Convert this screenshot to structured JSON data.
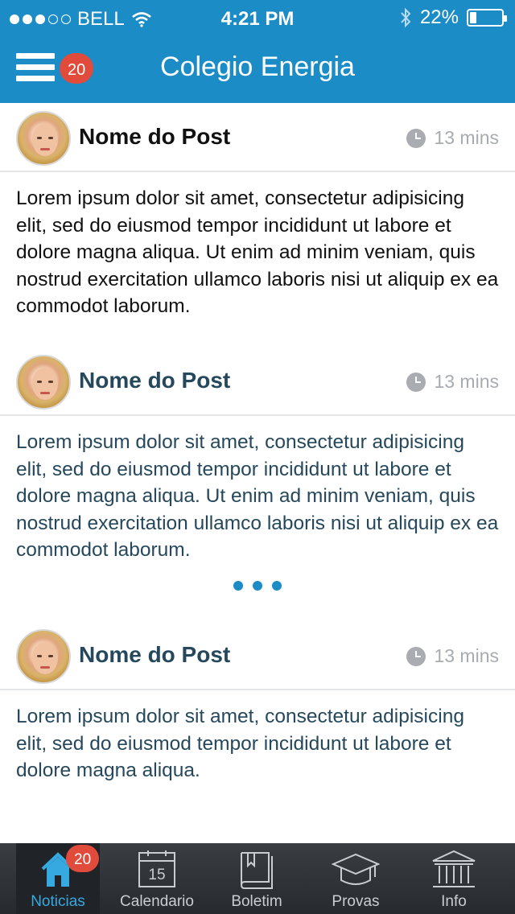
{
  "status_bar": {
    "carrier": "BELL",
    "time": "4:21 PM",
    "battery": "22%",
    "battery_level": 0.22,
    "signal_filled": 3,
    "signal_total": 5
  },
  "nav": {
    "title": "Colegio Energia",
    "menu_icon": "hamburger-menu-icon",
    "badge": "20"
  },
  "posts": [
    {
      "title": "Nome do Post",
      "time": "13 mins",
      "body": "Lorem ipsum dolor sit amet, consectetur adipisicing elit, sed do eiusmod tempor incididunt ut labore et dolore magna aliqua. Ut enim ad minim veniam, quis nostrud exercitation ullamco laboris nisi ut aliquip ex ea commodot laborum."
    },
    {
      "title": "Nome do Post",
      "time": "13 mins",
      "body": "Lorem ipsum dolor sit amet, consectetur adipisicing elit, sed do eiusmod tempor incididunt ut labore et dolore magna aliqua. Ut enim ad minim veniam, quis nostrud exercitation ullamco laboris nisi ut aliquip ex ea commodot laborum."
    },
    {
      "title": "Nome do Post",
      "time": "13 mins",
      "body": "Lorem ipsum dolor sit amet, consectetur adipisicing elit, sed do eiusmod tempor incididunt ut labore et dolore magna aliqua."
    }
  ],
  "tabs": [
    {
      "label": "Noticias",
      "icon": "home-icon",
      "badge": "20",
      "active": true
    },
    {
      "label": "Calendario",
      "icon": "calendar-icon",
      "day": "15"
    },
    {
      "label": "Boletim",
      "icon": "book-icon"
    },
    {
      "label": "Provas",
      "icon": "graduation-cap-icon"
    },
    {
      "label": "Info",
      "icon": "building-icon"
    }
  ],
  "colors": {
    "header": "#1c8cc7",
    "badge": "#e04b3b",
    "active_tab": "#36a9e1",
    "title_dark": "#111111",
    "title_blue": "#26485c"
  }
}
